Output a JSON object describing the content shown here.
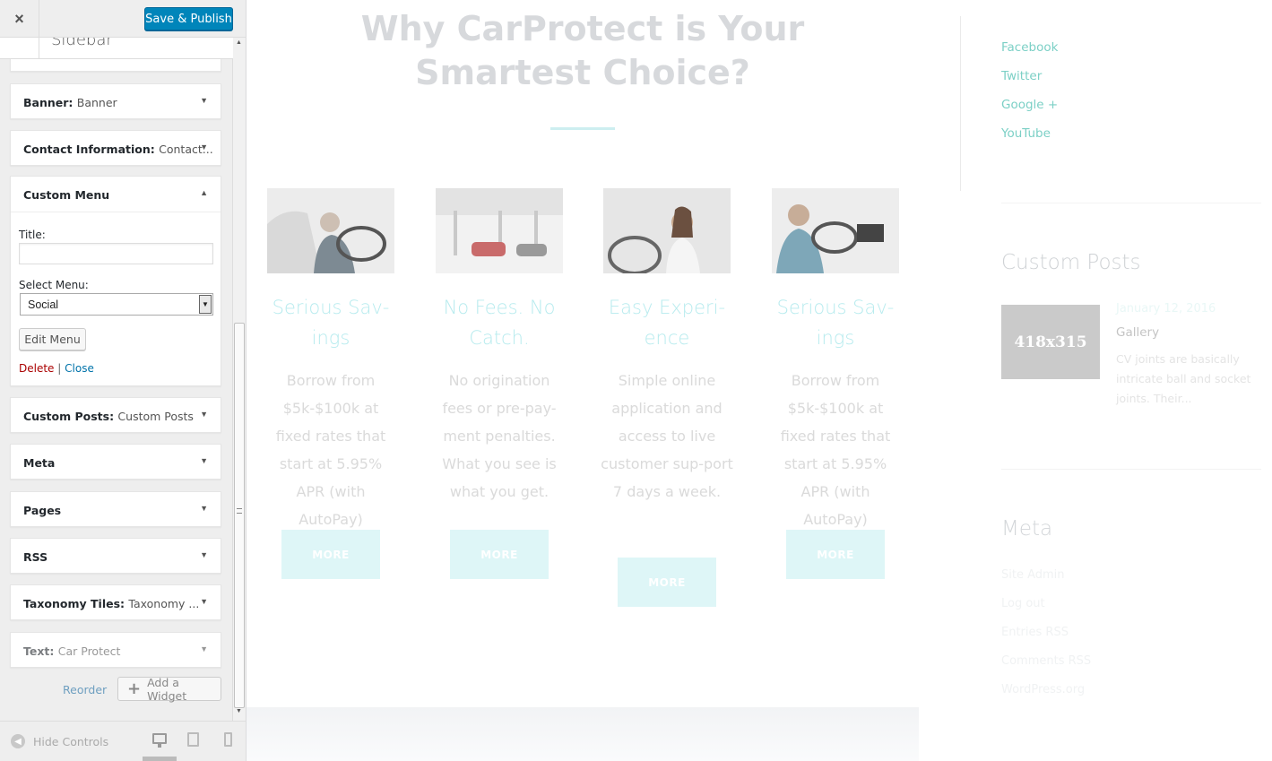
{
  "customizer": {
    "close_label": "×",
    "publish_label": "Save & Publish",
    "section_title": "Sidebar",
    "widgets_top": [
      {
        "title": "Banner",
        "sub": "Banner"
      },
      {
        "title": "Contact Information",
        "sub": "Contact..."
      }
    ],
    "custom_menu": {
      "title": "Custom Menu",
      "title_label": "Title:",
      "title_value": "",
      "select_label": "Select Menu:",
      "select_value": "Social",
      "edit_button": "Edit Menu",
      "delete_label": "Delete",
      "separator": "|",
      "close_label": "Close"
    },
    "widgets_bottom": [
      {
        "title": "Custom Posts",
        "sub": "Custom Posts"
      },
      {
        "title": "Meta",
        "sub": ""
      },
      {
        "title": "Pages",
        "sub": ""
      },
      {
        "title": "RSS",
        "sub": ""
      },
      {
        "title": "Taxonomy Tiles",
        "sub": "Taxonomy ..."
      },
      {
        "title": "Text",
        "sub": "Car Protect"
      }
    ],
    "reorder_label": "Reorder",
    "add_widget_label": "Add a Widget",
    "hide_controls_label": "Hide Controls"
  },
  "preview": {
    "headline": "Why CarProtect is Your Smartest Choice?",
    "cards": [
      {
        "title": "Serious Sav-ings",
        "text": "Borrow from $5k-$100k at fixed rates that start at 5.95% APR (with AutoPay)",
        "button": "MORE",
        "image": "driver-in-car"
      },
      {
        "title": "No Fees. No Catch.",
        "text": "No origination fees or pre-pay-ment penalties. What you see is what you get.",
        "button": "MORE",
        "image": "car-showroom"
      },
      {
        "title": "Easy Experi-ence",
        "text": "Simple online application and access to live customer sup-port 7 days a week.",
        "button": "MORE",
        "image": "woman-in-car"
      },
      {
        "title": "Serious Sav-ings",
        "text": "Borrow from $5k-$100k at fixed rates that start at 5.95% APR (with AutoPay)",
        "button": "MORE",
        "image": "man-driving"
      }
    ],
    "social_links": [
      "Facebook",
      "Twitter",
      "Google +",
      "YouTube"
    ],
    "custom_posts": {
      "heading": "Custom Posts",
      "thumb_label": "418x315",
      "date": "January 12, 2016",
      "post_title": "Gallery",
      "excerpt": "CV joints are basically intricate ball and socket joints. Their..."
    },
    "meta": {
      "heading": "Meta",
      "links": [
        "Site Admin",
        "Log out",
        "Entries RSS",
        "Comments RSS",
        "WordPress.org"
      ]
    }
  },
  "colors": {
    "publish": "#0085ba",
    "accent_teal": "#7cd0c6",
    "delete": "#aa0000",
    "link": "#0073aa"
  }
}
